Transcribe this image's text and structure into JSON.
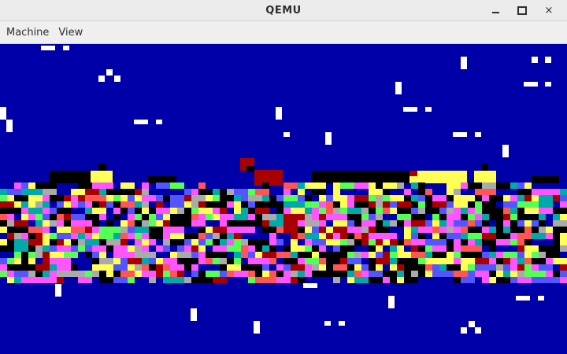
{
  "window": {
    "title": "QEMU",
    "controls": {
      "minimize": "minimize",
      "maximize": "maximize",
      "close": "×"
    }
  },
  "menubar": {
    "items": [
      {
        "label": "Machine"
      },
      {
        "label": "View"
      }
    ]
  },
  "screen": {
    "background_color": "#0000a8",
    "palette": [
      "#000000",
      "#ffffff",
      "#ffff55",
      "#ff55ff",
      "#aaaaaa",
      "#00aaaa",
      "#5555ff",
      "#55ff55",
      "#ff5555",
      "#a80000",
      "#0000a8"
    ],
    "content": "corrupted text-mode display (garbled colored blocks)"
  }
}
